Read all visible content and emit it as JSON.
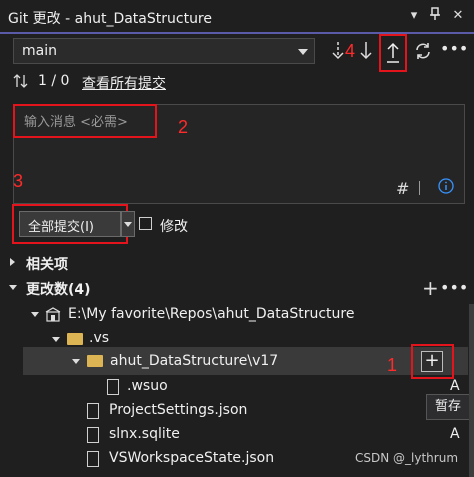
{
  "window": {
    "title": "Git 更改 - ahut_DataStructure"
  },
  "titlebar": {
    "dropdown_icon": "chevron-down-icon",
    "pin_icon": "pin-icon",
    "close_icon": "close-icon"
  },
  "branch": {
    "value": "main"
  },
  "toolbar": {
    "fetch_icon": "fetch-icon",
    "pull_icon": "pull-icon",
    "push_icon": "push-icon",
    "sync_icon": "sync-icon",
    "more_icon": "more-icon"
  },
  "sync_status": {
    "counts": "1 / 0",
    "view_all_link": "查看所有提交"
  },
  "message": {
    "placeholder": "输入消息 <必需>"
  },
  "commit": {
    "label": "全部提交(I)",
    "amend_label": "修改"
  },
  "sections": {
    "related": "相关项",
    "changes": "更改数(4)"
  },
  "tree": {
    "repo_path": "E:\\My favorite\\Repos\\ahut_DataStructure",
    "vs_folder": ".vs",
    "sub_folder": "ahut_DataStructure\\v17",
    "files": [
      {
        "name": ".wsuo",
        "status": "A"
      },
      {
        "name": "ProjectSettings.json",
        "status": ""
      },
      {
        "name": "slnx.sqlite",
        "status": "A"
      },
      {
        "name": "VSWorkspaceState.json",
        "status": ""
      }
    ]
  },
  "tooltip": {
    "stage": "暂存"
  },
  "annotations": {
    "n1": "1",
    "n2": "2",
    "n3": "3",
    "n4": "4"
  },
  "watermark": "CSDN @_lythrum",
  "colors": {
    "annotation_red": "#e3141c",
    "accent_blue": "#3794ff",
    "folder": "#dcb454"
  }
}
